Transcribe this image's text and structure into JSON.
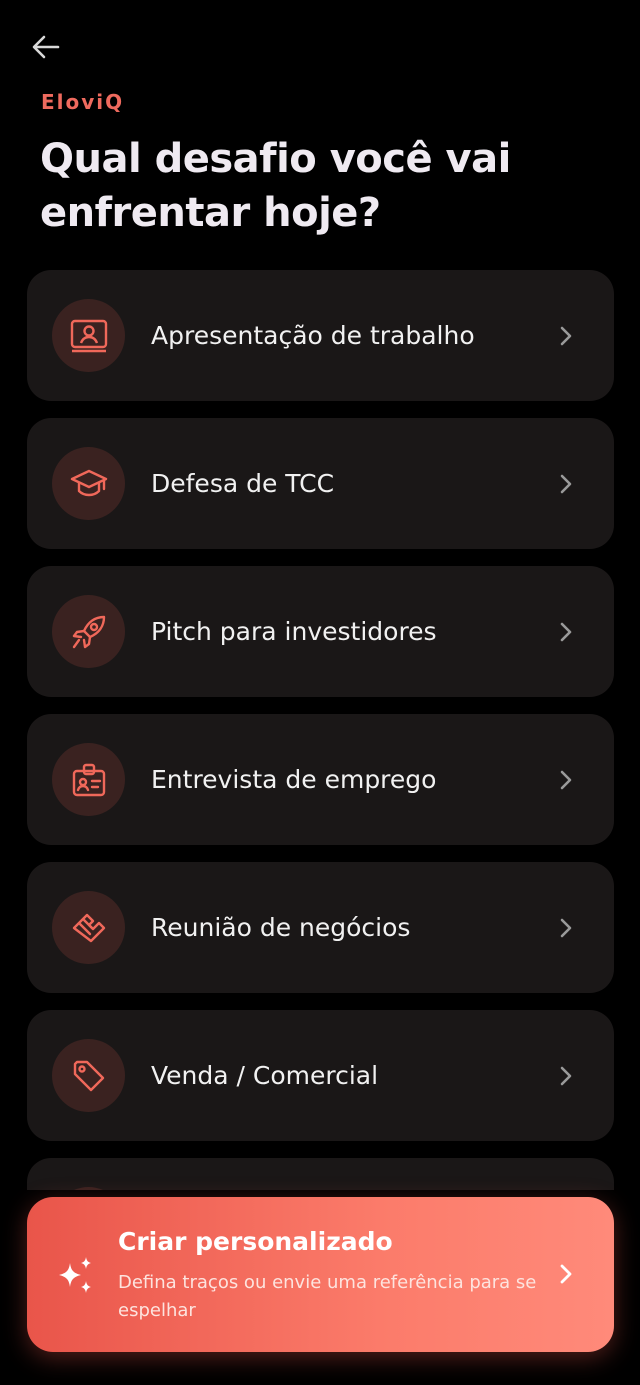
{
  "header": {
    "back_icon": "arrow-left-icon",
    "brand": "EloviQ",
    "title": "Qual desafio você vai enfrentar hoje?"
  },
  "colors": {
    "accent": "#ee6a5e",
    "card_bg": "#1a1717",
    "icon_bg": "#3a2220",
    "background": "#000000"
  },
  "challenges": [
    {
      "label": "Apresentação de trabalho",
      "icon": "presentation-user-icon"
    },
    {
      "label": "Defesa de TCC",
      "icon": "graduation-cap-icon"
    },
    {
      "label": "Pitch para investidores",
      "icon": "rocket-icon"
    },
    {
      "label": "Entrevista de emprego",
      "icon": "id-badge-icon"
    },
    {
      "label": "Reunião de negócios",
      "icon": "handshake-icon"
    },
    {
      "label": "Venda / Comercial",
      "icon": "price-tag-icon"
    },
    {
      "label": "",
      "icon": ""
    }
  ],
  "cta": {
    "icon": "sparkles-icon",
    "title": "Criar personalizado",
    "subtitle": "Defina traços ou envie uma referência para se espelhar"
  }
}
